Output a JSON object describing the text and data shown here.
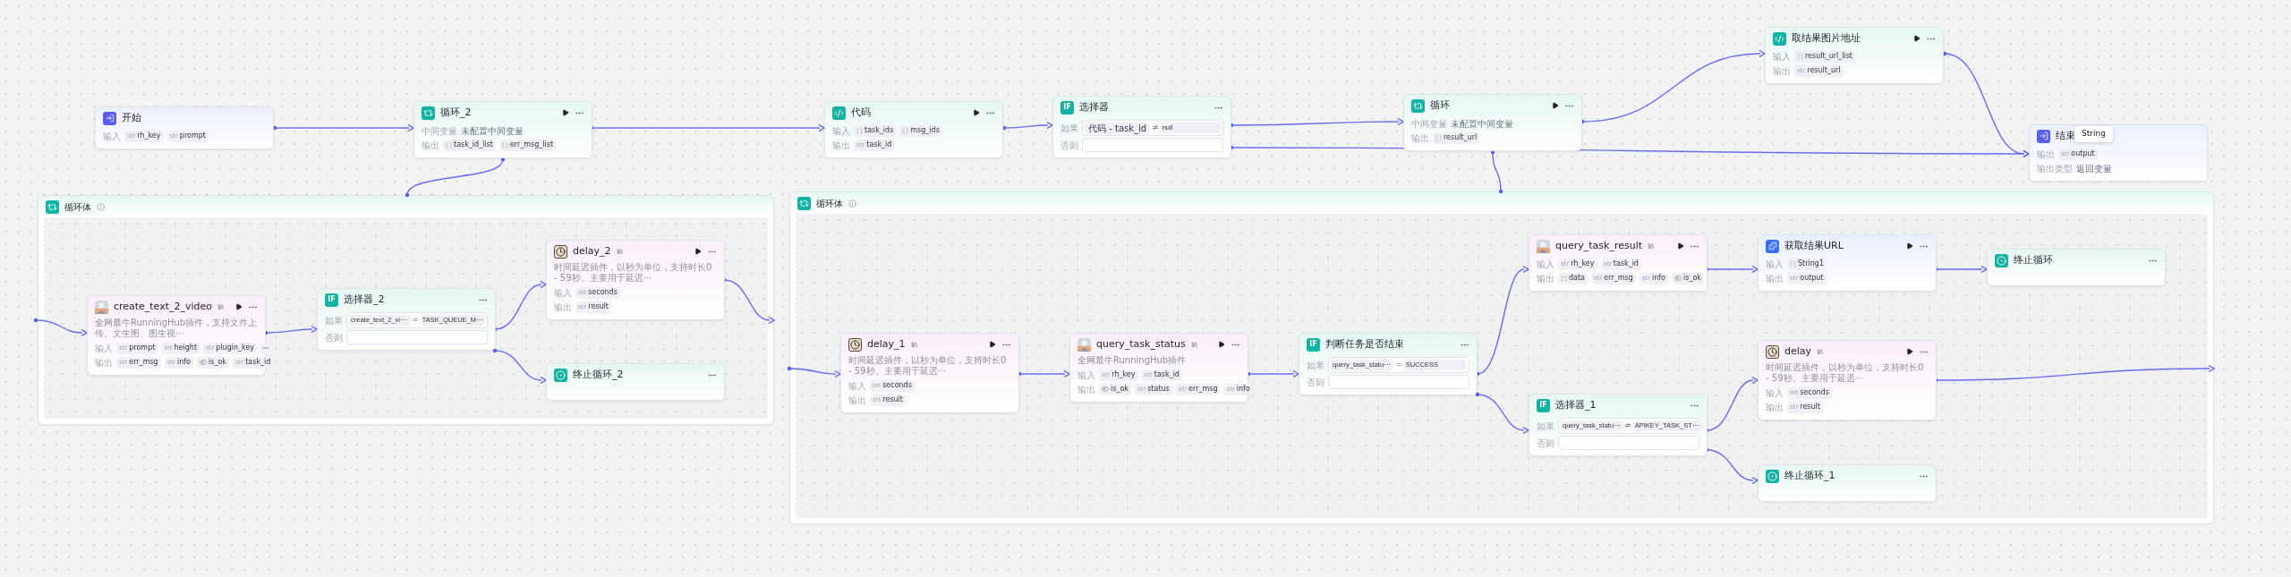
{
  "nodes": [
    {
      "kind": "start",
      "title": "开始",
      "run": false,
      "menu": false,
      "rows": [
        {
          "label": "输入",
          "params": [
            {
              "tag": "str",
              "name": "rh_key"
            },
            {
              "tag": "str",
              "name": "prompt"
            }
          ]
        }
      ]
    },
    {
      "kind": "loop",
      "title": "循环_2",
      "run": true,
      "menu": true,
      "rows": [
        {
          "label": "中间变量",
          "text": "未配置中间变量"
        },
        {
          "label": "输出",
          "params": [
            {
              "kind": "array",
              "name": "task_id_list"
            },
            {
              "kind": "array",
              "name": "err_msg_list"
            }
          ]
        }
      ]
    },
    {
      "kind": "code",
      "title": "代码",
      "run": true,
      "menu": true,
      "rows": [
        {
          "label": "输入",
          "params": [
            {
              "kind": "array",
              "name": "task_ids"
            },
            {
              "kind": "array",
              "name": "msg_ids"
            }
          ]
        },
        {
          "label": "输出",
          "params": [
            {
              "tag": "str",
              "name": "task_id"
            }
          ]
        }
      ]
    },
    {
      "kind": "if",
      "badge": "IF",
      "title": "选择器",
      "run": false,
      "menu": true,
      "conditions": [
        {
          "label": "如果",
          "left": "代码 - task_id",
          "op": "≠",
          "right": "null"
        },
        {
          "label": "否则"
        }
      ]
    },
    {
      "kind": "loop",
      "title": "循环",
      "run": true,
      "menu": true,
      "rows": [
        {
          "label": "中间变量",
          "text": "未配置中间变量"
        },
        {
          "label": "输出",
          "params": [
            {
              "kind": "array",
              "name": "result_url"
            }
          ]
        }
      ]
    },
    {
      "kind": "code",
      "title": "取结果图片地址",
      "run": true,
      "menu": true,
      "rows": [
        {
          "label": "输入",
          "params": [
            {
              "kind": "array",
              "name": "result_url_list"
            }
          ]
        },
        {
          "label": "输出",
          "params": [
            {
              "tag": "str",
              "name": "result_url"
            }
          ]
        }
      ]
    },
    {
      "kind": "end",
      "title": "结束",
      "run": false,
      "menu": false,
      "rows": [
        {
          "label": "输出",
          "params": [
            {
              "tag": "str",
              "name": "output"
            }
          ]
        },
        {
          "label": "输出类型",
          "text": "返回变量"
        }
      ]
    }
  ],
  "tooltip": "String",
  "loop_bodies": [
    {
      "title": "循环体",
      "nodes": [
        {
          "kind": "plugin",
          "title": "create_text_2_video",
          "info_badge": true,
          "run": true,
          "menu": true,
          "description": "全网最牛RunningHub插件，支持文件上传、文生图、图生视⋯",
          "rows": [
            {
              "label": "输入",
              "params": [
                {
                  "tag": "str",
                  "name": "prompt"
                },
                {
                  "tag": "int",
                  "name": "height"
                },
                {
                  "tag": "str",
                  "name": "plugin_key"
                }
              ],
              "more": true
            },
            {
              "label": "输出",
              "params": [
                {
                  "tag": "str",
                  "name": "err_msg"
                },
                {
                  "tag": "str",
                  "name": "info"
                },
                {
                  "kind": "bool",
                  "name": "is_ok"
                },
                {
                  "tag": "str",
                  "name": "task_id"
                }
              ]
            }
          ]
        },
        {
          "kind": "if",
          "badge": "IF",
          "title": "选择器_2",
          "run": false,
          "menu": true,
          "conditions": [
            {
              "label": "如果",
              "left": "create_text_2_vi⋯",
              "op": "=",
              "right": "TASK_QUEUE_M⋯"
            },
            {
              "label": "否则"
            }
          ]
        },
        {
          "kind": "delay",
          "title": "delay_2",
          "info_badge": true,
          "run": true,
          "menu": true,
          "description": "时间延迟插件，以秒为单位，支持时长0 - 59秒。主要用于延迟⋯",
          "rows": [
            {
              "label": "输入",
              "params": [
                {
                  "tag": "int",
                  "name": "seconds"
                }
              ]
            },
            {
              "label": "输出",
              "params": [
                {
                  "tag": "str",
                  "name": "result"
                }
              ]
            }
          ]
        },
        {
          "kind": "break",
          "title": "终止循环_2",
          "run": false,
          "menu": true
        }
      ]
    },
    {
      "title": "循环体",
      "nodes": [
        {
          "kind": "delay",
          "title": "delay_1",
          "info_badge": true,
          "run": true,
          "menu": true,
          "description": "时间延迟插件，以秒为单位，支持时长0 - 59秒。主要用于延迟⋯",
          "rows": [
            {
              "label": "输入",
              "params": [
                {
                  "tag": "int",
                  "name": "seconds"
                }
              ]
            },
            {
              "label": "输出",
              "params": [
                {
                  "tag": "str",
                  "name": "result"
                }
              ]
            }
          ]
        },
        {
          "kind": "plugin",
          "title": "query_task_status",
          "info_badge": true,
          "run": true,
          "menu": true,
          "description": "全网最牛RunningHub插件",
          "rows": [
            {
              "label": "输入",
              "params": [
                {
                  "tag": "str",
                  "name": "rh_key"
                },
                {
                  "tag": "str",
                  "name": "task_id"
                }
              ]
            },
            {
              "label": "输出",
              "params": [
                {
                  "kind": "bool",
                  "name": "is_ok"
                },
                {
                  "tag": "str",
                  "name": "status"
                },
                {
                  "tag": "str",
                  "name": "err_msg"
                },
                {
                  "tag": "str",
                  "name": "info"
                }
              ]
            }
          ]
        },
        {
          "kind": "if",
          "badge": "IF",
          "title": "判断任务是否结束",
          "run": false,
          "menu": true,
          "conditions": [
            {
              "label": "如果",
              "left": "query_task_statu⋯",
              "op": "=",
              "right": "SUCCESS"
            },
            {
              "label": "否则"
            }
          ]
        },
        {
          "kind": "plugin",
          "title": "query_task_result",
          "info_badge": true,
          "run": true,
          "menu": true,
          "rows": [
            {
              "label": "输入",
              "params": [
                {
                  "tag": "str",
                  "name": "rh_key"
                },
                {
                  "tag": "str",
                  "name": "task_id"
                }
              ]
            },
            {
              "label": "输出",
              "params": [
                {
                  "kind": "array",
                  "name": "data"
                },
                {
                  "tag": "str",
                  "name": "err_msg"
                },
                {
                  "tag": "str",
                  "name": "info"
                },
                {
                  "kind": "bool",
                  "name": "is_ok"
                }
              ]
            }
          ]
        },
        {
          "kind": "tool",
          "title": "获取结果URL",
          "run": true,
          "menu": true,
          "rows": [
            {
              "label": "输入",
              "params": [
                {
                  "kind": "array",
                  "name": "String1"
                }
              ]
            },
            {
              "label": "输出",
              "params": [
                {
                  "tag": "str",
                  "name": "output"
                }
              ]
            }
          ]
        },
        {
          "kind": "break",
          "title": "终止循环",
          "run": false,
          "menu": true
        },
        {
          "kind": "delay",
          "title": "delay",
          "info_badge": true,
          "run": true,
          "menu": true,
          "description": "时间延迟插件，以秒为单位，支持时长0 - 59秒。主要用于延迟⋯",
          "rows": [
            {
              "label": "输入",
              "params": [
                {
                  "tag": "int",
                  "name": "seconds"
                }
              ]
            },
            {
              "label": "输出",
              "params": [
                {
                  "tag": "str",
                  "name": "result"
                }
              ]
            }
          ]
        },
        {
          "kind": "if",
          "badge": "IF",
          "title": "选择器_1",
          "run": false,
          "menu": true,
          "conditions": [
            {
              "label": "如果",
              "left": "query_task_statu⋯",
              "op": "≠",
              "right": "APIKEY_TASK_ST⋯"
            },
            {
              "label": "否则"
            }
          ]
        },
        {
          "kind": "break",
          "title": "终止循环_1",
          "run": false,
          "menu": true
        }
      ]
    }
  ]
}
